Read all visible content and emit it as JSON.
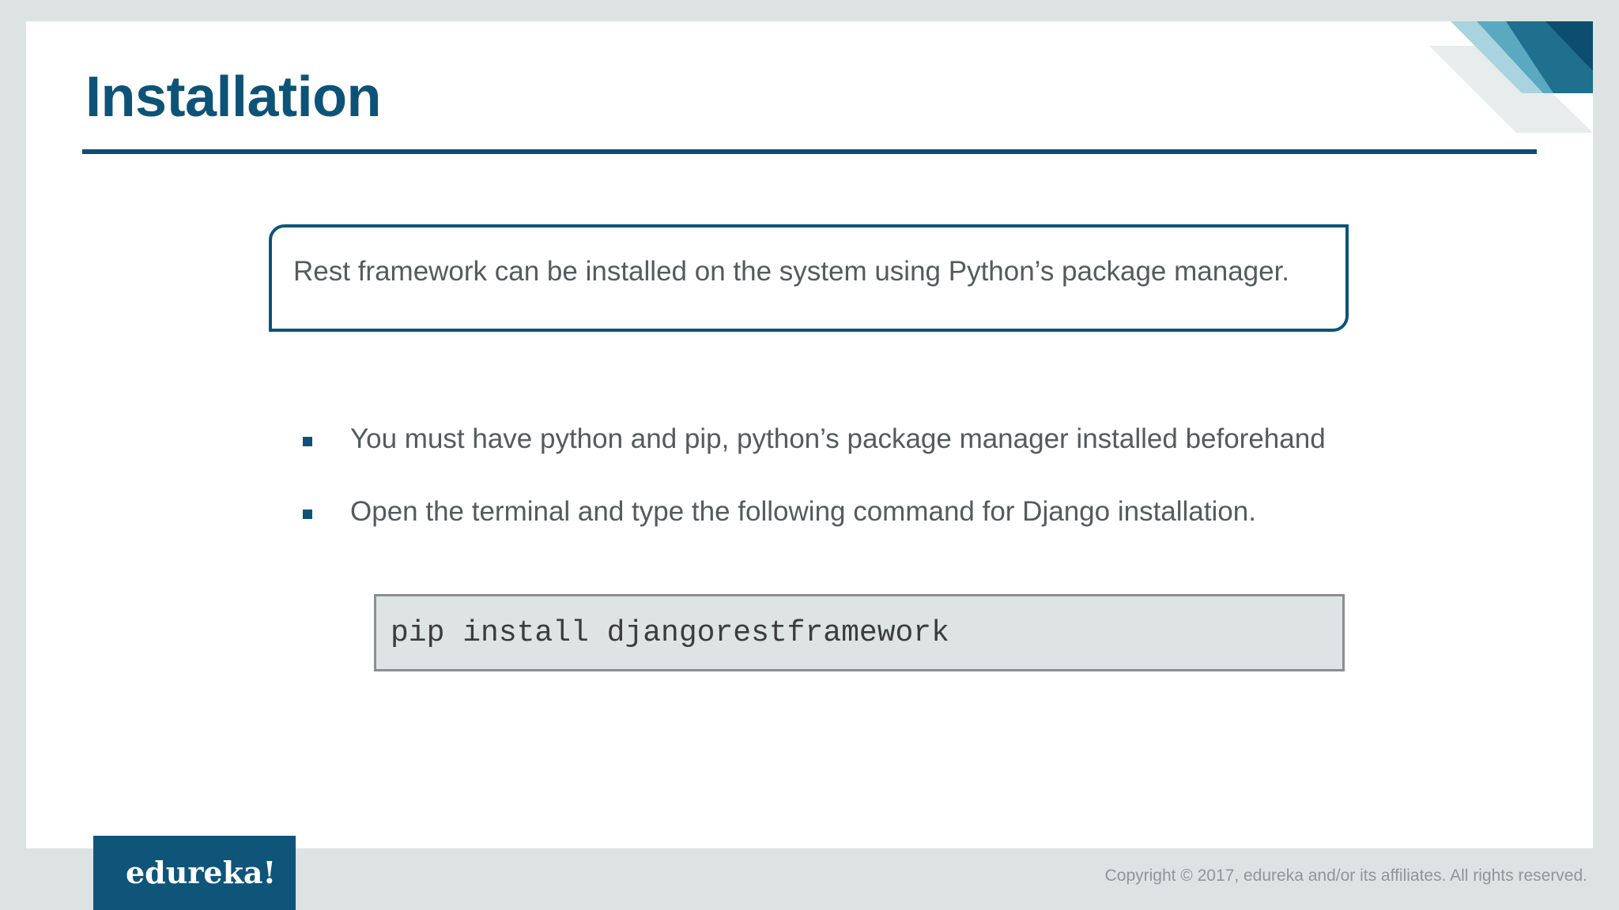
{
  "slide": {
    "title": "Installation",
    "intro": "Rest framework can be installed on the system using Python’s package manager.",
    "bullets": [
      "You must have python and pip, python’s package manager installed beforehand",
      "Open the terminal and type the following command for Django installation."
    ],
    "command": "pip install djangorestframework"
  },
  "footer": {
    "logo": "edureka!",
    "copyright": "Copyright © 2017, edureka and/or its affiliates. All rights reserved."
  },
  "colors": {
    "accent": "#0d5378",
    "body_text": "#555a5c",
    "code_background": "#dee3e3",
    "frame_background": "#dde3e3"
  }
}
